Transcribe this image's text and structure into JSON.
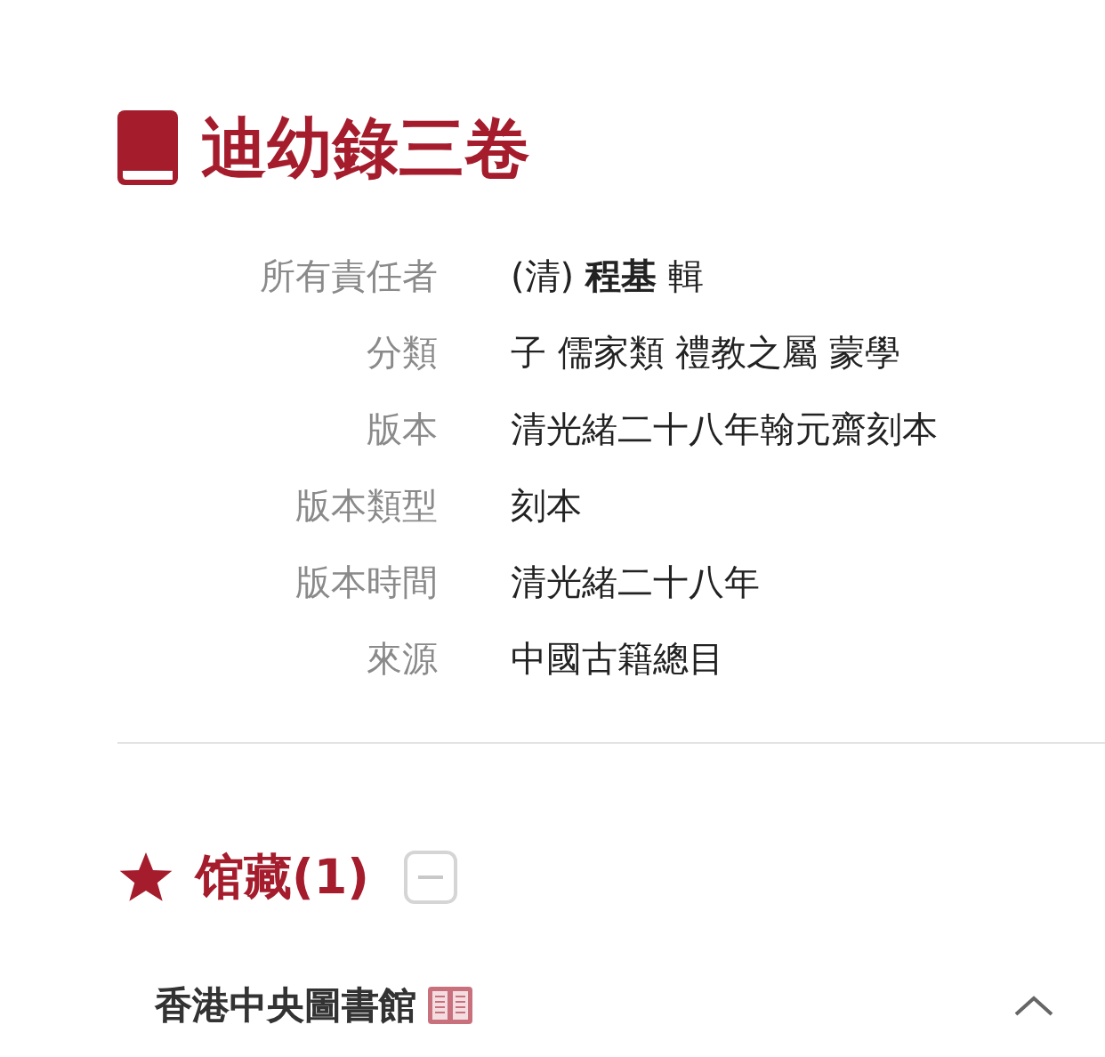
{
  "title": "迪幼錄三卷",
  "fields": [
    {
      "label": "所有責任者",
      "value": "(清) **程基**  輯"
    },
    {
      "label": "分類",
      "value": "子 儒家類 禮教之屬 蒙學"
    },
    {
      "label": "版本",
      "value": "清光緒二十八年翰元齋刻本"
    },
    {
      "label": "版本類型",
      "value": "刻本"
    },
    {
      "label": "版本時間",
      "value": "清光緒二十八年"
    },
    {
      "label": "來源",
      "value": "中國古籍總目"
    }
  ],
  "holdings": {
    "title": "馆藏(1)",
    "expanded": true,
    "libraries": [
      {
        "name": "香港中央圖書館",
        "expanded": true
      }
    ]
  }
}
